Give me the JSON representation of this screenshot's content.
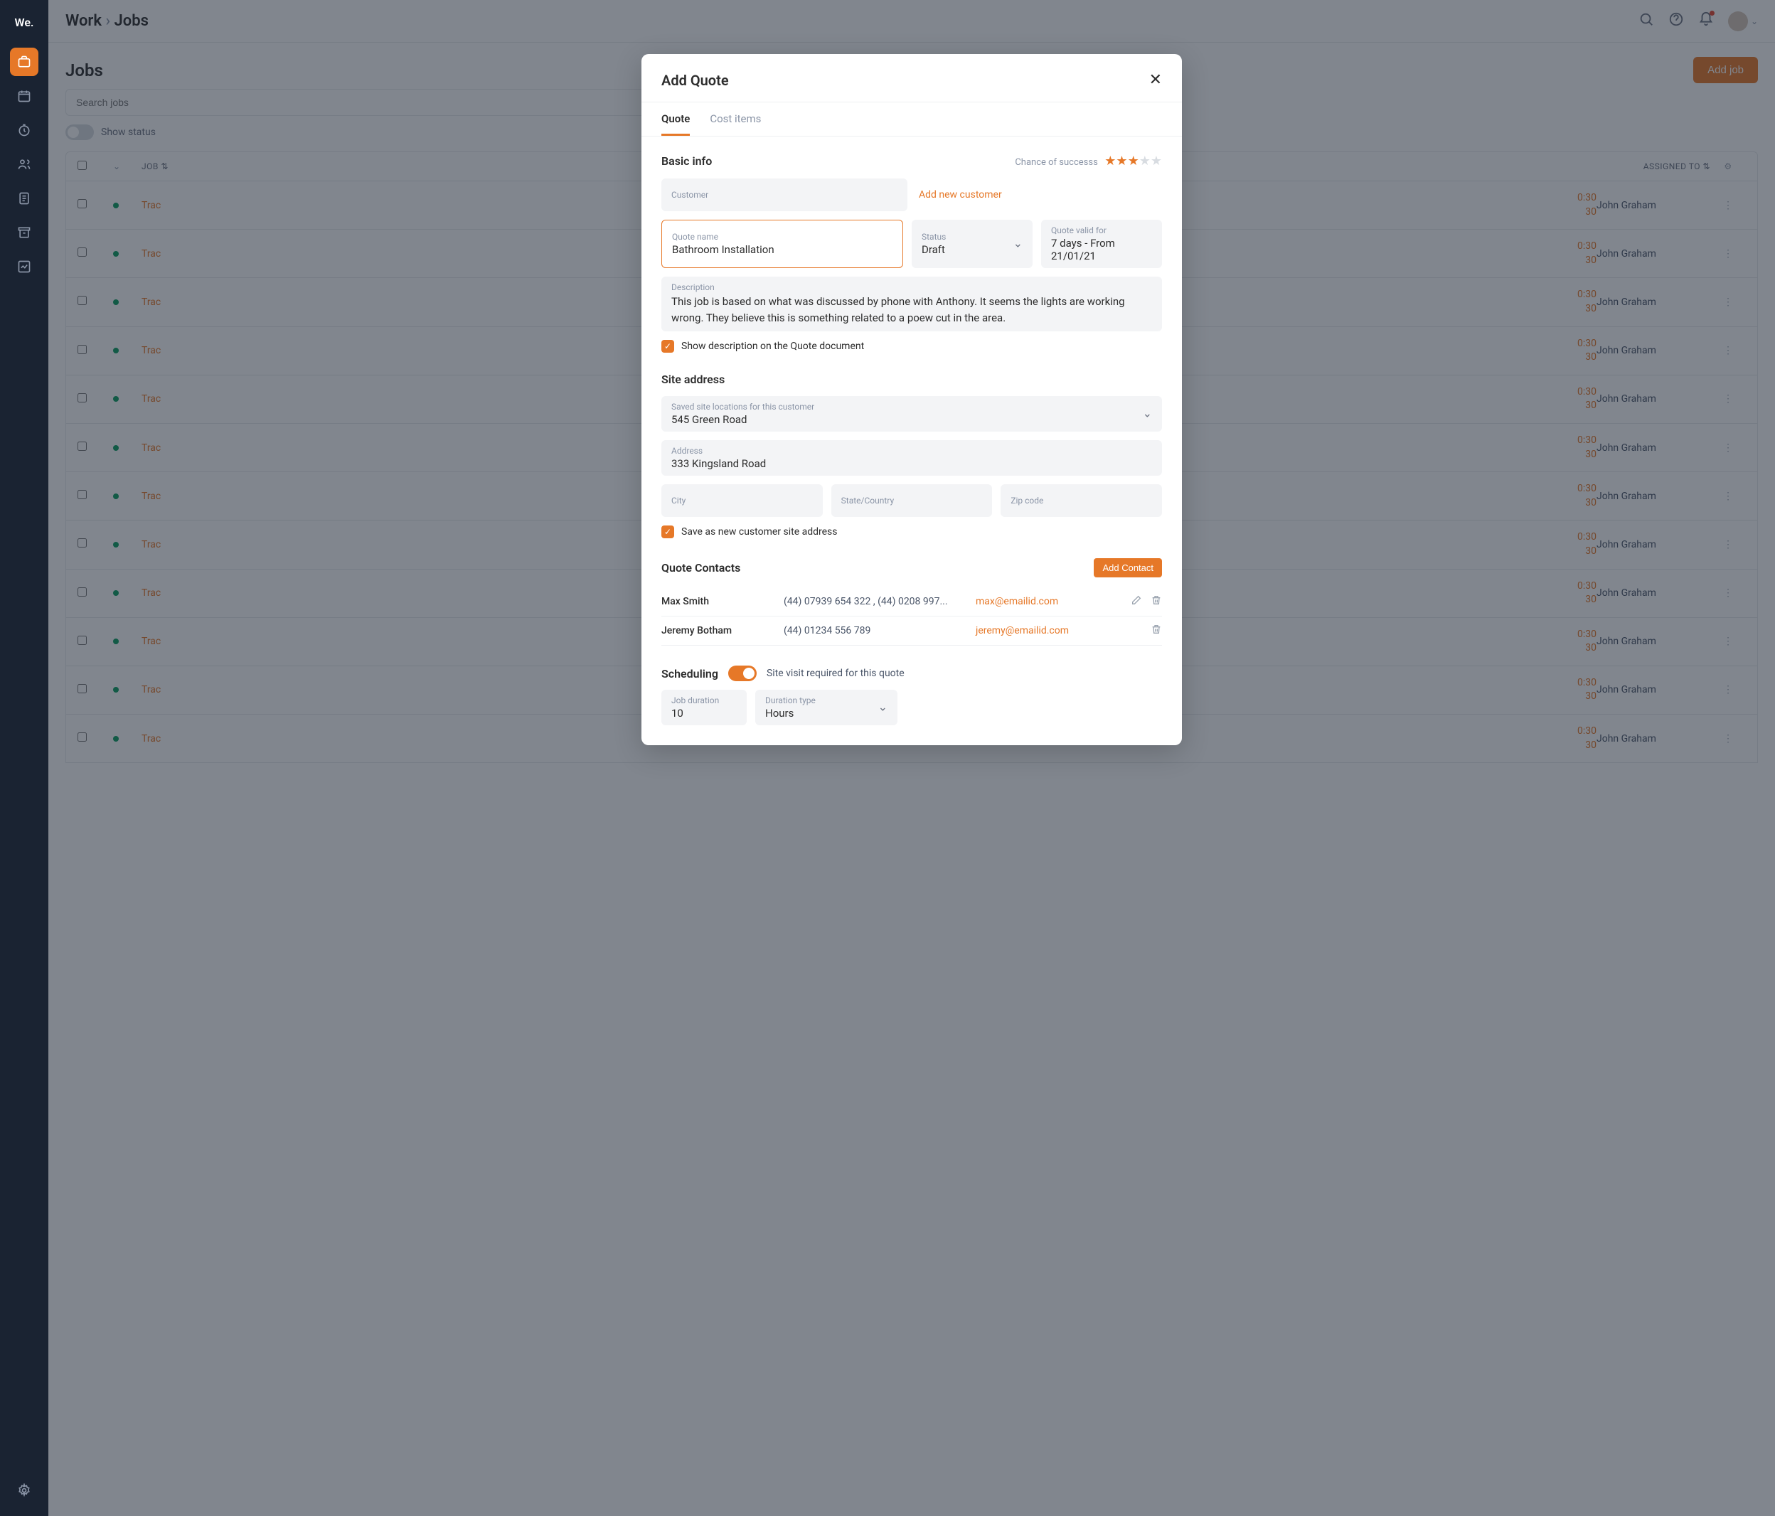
{
  "sidebar": {
    "logo": "We."
  },
  "breadcrumb": {
    "section": "Work",
    "sep": "›",
    "page": "Jobs"
  },
  "page": {
    "title": "Jobs",
    "add_job": "Add job",
    "search_placeholder": "Search jobs",
    "show_status": "Show status"
  },
  "table": {
    "col_job": "JOB",
    "col_assigned": "ASSIGNED TO",
    "rows": [
      {
        "job": "Trac",
        "t1": "0:30",
        "t2": "30",
        "assignee": "John Graham"
      },
      {
        "job": "Trac",
        "t1": "0:30",
        "t2": "30",
        "assignee": "John Graham"
      },
      {
        "job": "Trac",
        "t1": "0:30",
        "t2": "30",
        "assignee": "John Graham"
      },
      {
        "job": "Trac",
        "t1": "0:30",
        "t2": "30",
        "assignee": "John Graham"
      },
      {
        "job": "Trac",
        "t1": "0:30",
        "t2": "30",
        "assignee": "John Graham"
      },
      {
        "job": "Trac",
        "t1": "0:30",
        "t2": "30",
        "assignee": "John Graham"
      },
      {
        "job": "Trac",
        "t1": "0:30",
        "t2": "30",
        "assignee": "John Graham"
      },
      {
        "job": "Trac",
        "t1": "0:30",
        "t2": "30",
        "assignee": "John Graham"
      },
      {
        "job": "Trac",
        "t1": "0:30",
        "t2": "30",
        "assignee": "John Graham"
      },
      {
        "job": "Trac",
        "t1": "0:30",
        "t2": "30",
        "assignee": "John Graham"
      },
      {
        "job": "Trac",
        "t1": "0:30",
        "t2": "30",
        "assignee": "John Graham"
      },
      {
        "job": "Trac",
        "t1": "0:30",
        "t2": "30",
        "assignee": "John Graham"
      }
    ]
  },
  "modal": {
    "title": "Add Quote",
    "tabs": {
      "quote": "Quote",
      "cost_items": "Cost items"
    },
    "basic_info": {
      "heading": "Basic info",
      "chance_label": "Chance of successs",
      "stars_filled": 3,
      "stars_total": 5,
      "customer_label": "Customer",
      "add_customer": "Add new customer",
      "quote_name_label": "Quote name",
      "quote_name": "Bathroom Installation",
      "status_label": "Status",
      "status": "Draft",
      "valid_label": "Quote valid for",
      "valid": "7 days - From 21/01/21",
      "desc_label": "Description",
      "desc": "This job is based on what was discussed by phone with Anthony. It seems the lights are working wrong. They believe this is something related to a poew cut in the area.",
      "show_desc_check": "Show description on the Quote document"
    },
    "site_address": {
      "heading": "Site address",
      "saved_label": "Saved site locations for this customer",
      "saved": "545 Green Road",
      "address_label": "Address",
      "address": "333 Kingsland Road",
      "city_label": "City",
      "state_label": "State/Country",
      "zip_label": "Zip code",
      "save_new_check": "Save as new customer site address"
    },
    "contacts": {
      "heading": "Quote Contacts",
      "add_button": "Add Contact",
      "rows": [
        {
          "name": "Max Smith",
          "phone": "(44) 07939 654 322 , (44) 0208 997...",
          "email": "max@emailid.com",
          "editable": true
        },
        {
          "name": "Jeremy Botham",
          "phone": "(44) 01234 556 789",
          "email": "jeremy@emailid.com",
          "editable": false
        }
      ]
    },
    "scheduling": {
      "heading": "Scheduling",
      "note": "Site visit required for this quote",
      "duration_label": "Job duration",
      "duration": "10",
      "type_label": "Duration type",
      "type": "Hours"
    }
  }
}
